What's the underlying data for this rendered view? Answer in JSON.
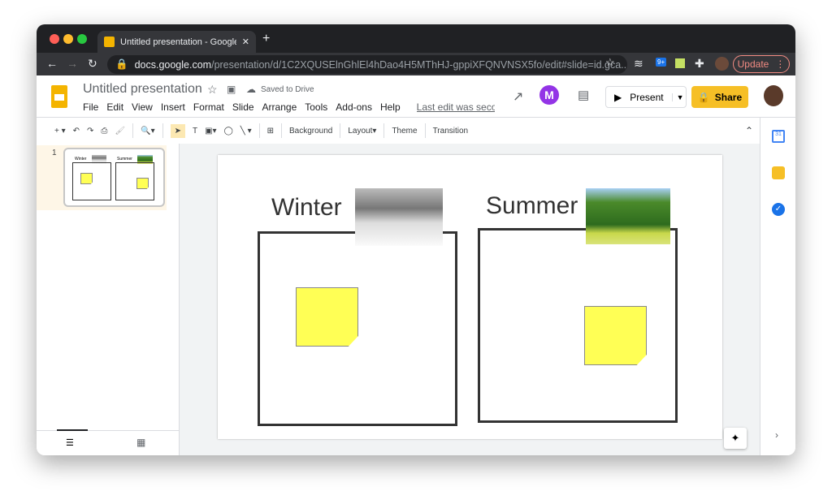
{
  "browser": {
    "tab_title": "Untitled presentation - Google",
    "url_host": "docs.google.com",
    "url_path": "/presentation/d/1C2XQUSElnGhlEl4hDao4H5MThHJ-gppiXFQNVNSX5fo/edit#slide=id.gca...",
    "update_label": "Update",
    "ext_badge": "9+"
  },
  "doc": {
    "title": "Untitled presentation",
    "saved": "Saved to Drive",
    "menu": [
      "File",
      "Edit",
      "View",
      "Insert",
      "Format",
      "Slide",
      "Arrange",
      "Tools",
      "Add-ons",
      "Help"
    ],
    "last_edit": "Last edit was seconds ago",
    "present": "Present",
    "share": "Share"
  },
  "toolbar": {
    "background": "Background",
    "layout": "Layout",
    "theme": "Theme",
    "transition": "Transition"
  },
  "filmstrip": {
    "slide_number": "1"
  },
  "slide": {
    "left_title": "Winter",
    "right_title": "Summer"
  },
  "colors": {
    "sticky": "#ffff55",
    "share": "#f6bf26",
    "accent": "#f4b400"
  }
}
